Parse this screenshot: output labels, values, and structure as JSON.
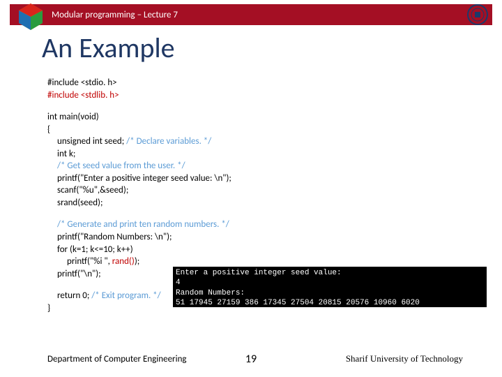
{
  "header": {
    "breadcrumb": "Modular programming – Lecture 7"
  },
  "title": "An Example",
  "code": {
    "inc1": "#include <stdio. h>",
    "inc2": "#include <stdlib. h>",
    "main_sig": "int main(void)",
    "brace_open": "{",
    "l1a": "unsigned int seed; ",
    "l1b": "/*  Declare variables.  */",
    "l2": "int k;",
    "l3": "/*  Get seed value from the user.  */",
    "l4": "printf(\"Enter a positive integer seed value: \\n\");",
    "l5": "scanf(\"%u\",&seed);",
    "l6": "srand(seed);",
    "l7": "/*  Generate and print ten random numbers.  */",
    "l8": "printf(\"Random Numbers: \\n\");",
    "l9": "for (k=1; k<=10; k++)",
    "l10a": "printf(\"%i \", ",
    "l10b": "rand()",
    "l10c": ");",
    "l11": "printf(\"\\n\");",
    "l12a": "return 0; ",
    "l12b": "/*  Exit program.  */",
    "brace_close": "}"
  },
  "console": {
    "line1": "Enter a positive integer seed value:",
    "line2": "4",
    "line3": "Random Numbers:",
    "line4": "51 17945 27159 386 17345 27504 20815 20576 10960 6020"
  },
  "footer": {
    "dept": "Department of Computer Engineering",
    "page": "19",
    "uni": "Sharif University of Technology"
  }
}
